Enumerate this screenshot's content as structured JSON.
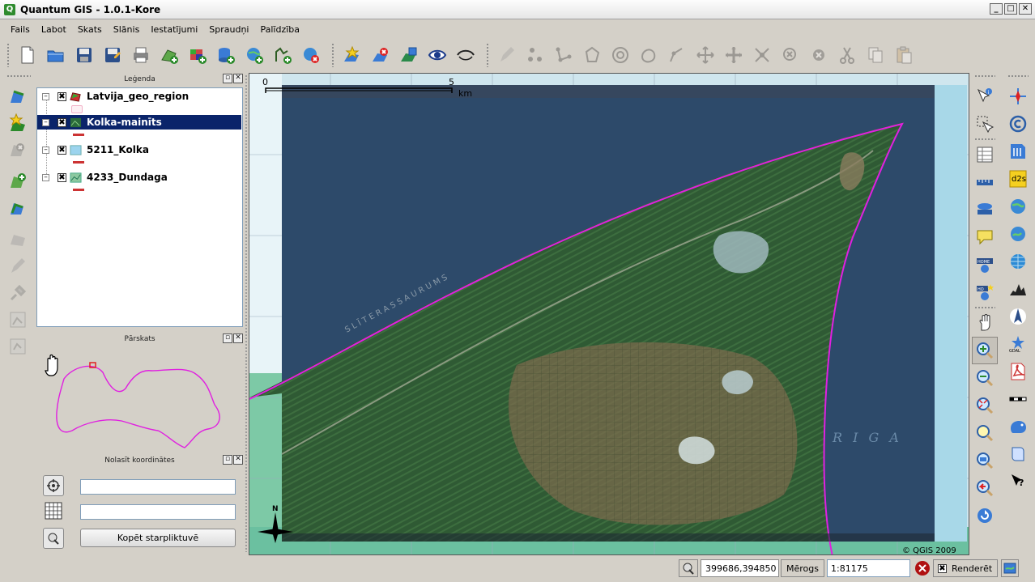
{
  "window": {
    "title": "Quantum GIS - 1.0.1-Kore",
    "app_icon": "Q",
    "controls": [
      "_",
      "□",
      "✕"
    ]
  },
  "menu": [
    "Fails",
    "Labot",
    "Skats",
    "Slānis",
    "Iestatījumi",
    "Spraudņi",
    "Palīdzība"
  ],
  "legend": {
    "title": "Leģenda",
    "layers": [
      {
        "name": "Latvija_geo_region",
        "checked": "✖",
        "selected": false,
        "icon": "polygon-layer-icon",
        "swatch": "#f6c8d8"
      },
      {
        "name": "Kolka-mainīts",
        "checked": "✖",
        "selected": true,
        "icon": "raster-layer-icon",
        "swatch": "#c33"
      },
      {
        "name": "5211_Kolka",
        "checked": "✖",
        "selected": false,
        "icon": "raster-layer-icon",
        "swatch": "#c33"
      },
      {
        "name": "4233_Dundaga",
        "checked": "✖",
        "selected": false,
        "icon": "raster-layer-icon",
        "swatch": "#c33"
      }
    ]
  },
  "overview": {
    "title": "Pārskats"
  },
  "coords": {
    "title": "Nolasīt koordinātes",
    "field1": "",
    "field2": "",
    "copy_button": "Kopēt starpliktuvē"
  },
  "map": {
    "scale_start": "0",
    "scale_end": "5",
    "scale_unit": "km",
    "north": "N",
    "copyright": "© QGIS 2009",
    "labels": {
      "gulf": "R I G A",
      "coast": "S L Ī T E R A S   S A U R U M S"
    }
  },
  "status": {
    "coordinates": "399686,394850",
    "scale_label": "Mērogs",
    "scale_value": "1:81175",
    "render_label": "Renderēt",
    "render_checked": "✖"
  },
  "colors": {
    "selection": "#0a246a",
    "boundary": "#e020e0",
    "sea": "#2d4a6a",
    "forest": "#2f5a34"
  }
}
